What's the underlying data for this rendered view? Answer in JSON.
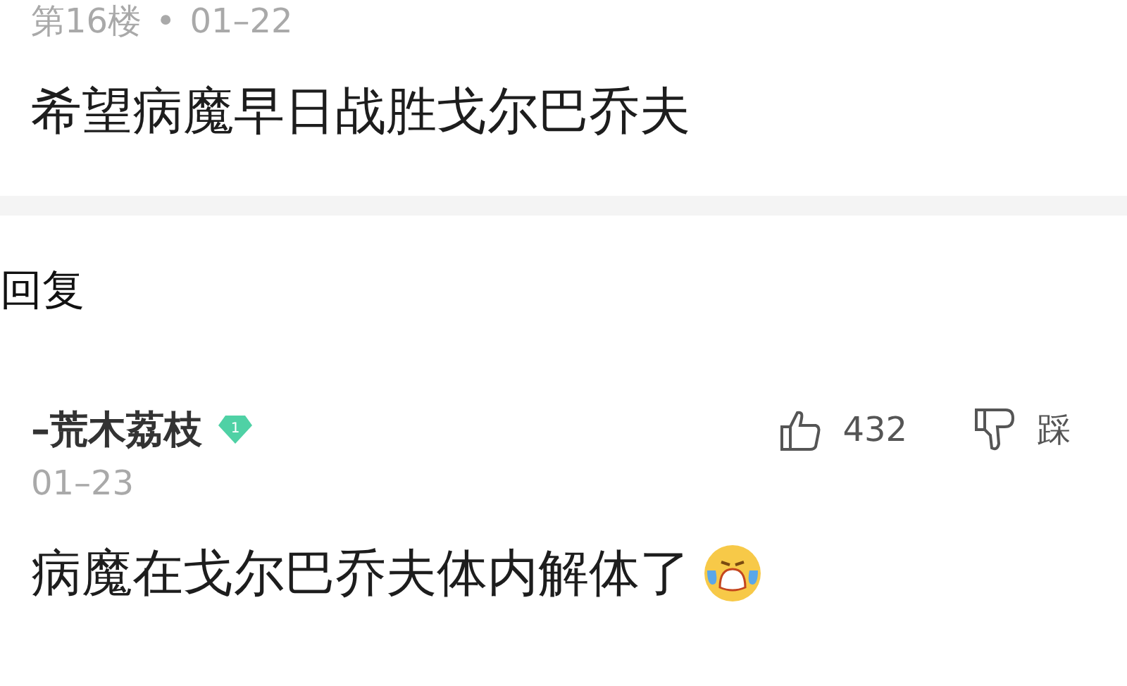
{
  "previous_comment": {
    "floor": "第16楼",
    "separator": "•",
    "date": "01–22",
    "text": "希望病魔早日战胜戈尔巴乔夫"
  },
  "reply_header": {
    "title": "回复"
  },
  "comment": {
    "username": "–荒木荔枝",
    "level_badge": "1",
    "date": "01–23",
    "likes": "432",
    "dislike_label": "踩",
    "text": "病魔在戈尔巴乔夫体内解体了",
    "emoji": {
      "kind": "crying"
    }
  }
}
